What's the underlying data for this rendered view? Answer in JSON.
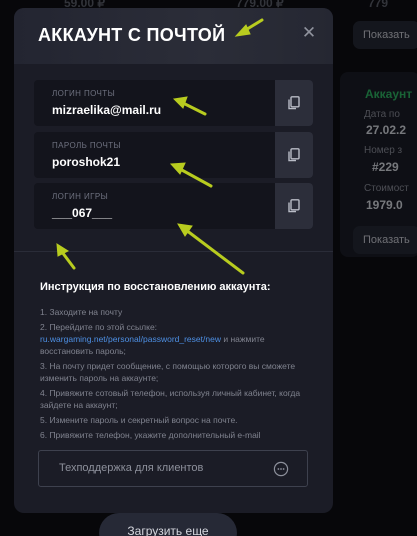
{
  "background": {
    "price_left": "59.00 ₽",
    "price_mid": "779.00 ₽",
    "price_right": "779",
    "show_button": "Показать",
    "right_card": {
      "status": "Аккаунт",
      "date_label": "Дата по",
      "date_value": "27.02.2",
      "number_label": "Номер з",
      "number_value": "#229",
      "cost_label": "Стоимост",
      "cost_value": "1979.0",
      "show_button": "Показать"
    },
    "load_more": "Загрузить еще"
  },
  "modal": {
    "title": "АККАУНТ С ПОЧТОЙ",
    "close_glyph": "✕",
    "fields": [
      {
        "label": "ЛОГИН ПОЧТЫ",
        "value": "mizraelika@mail.ru"
      },
      {
        "label": "ПАРОЛЬ ПОЧТЫ",
        "value": "poroshok21"
      },
      {
        "label": "ЛОГИН ИГРЫ",
        "value": "___067___"
      }
    ],
    "instructions_title": "Инструкция по восстановлению аккаунта:",
    "steps": [
      "1. Заходите на почту",
      "2. Перейдите по этой ссылке:",
      "3. На почту придет сообщение, с помощью которого вы сможете изменить пароль на аккаунте;",
      "4. Привяжите сотовый телефон, используя личный кабинет, когда зайдете на аккаунт;",
      "5. Измените пароль и секретный вопрос на почте.",
      "6. Привяжите телефон, укажите дополнительный e-mail"
    ],
    "step2_link": "ru.wargaming.net/personal/password_reset/new",
    "step2_suffix": " и нажмите восстановить пароль;",
    "support_label": "Техподдержка для клиентов"
  },
  "colors": {
    "modal_bg": "#1b1c26",
    "field_bg": "#13141c",
    "link": "#4d8fe3",
    "annotation_arrow": "#b8cc1f",
    "status_green": "#2fb463"
  },
  "icons": [
    "close-icon",
    "copy-icon",
    "chat-icon"
  ]
}
